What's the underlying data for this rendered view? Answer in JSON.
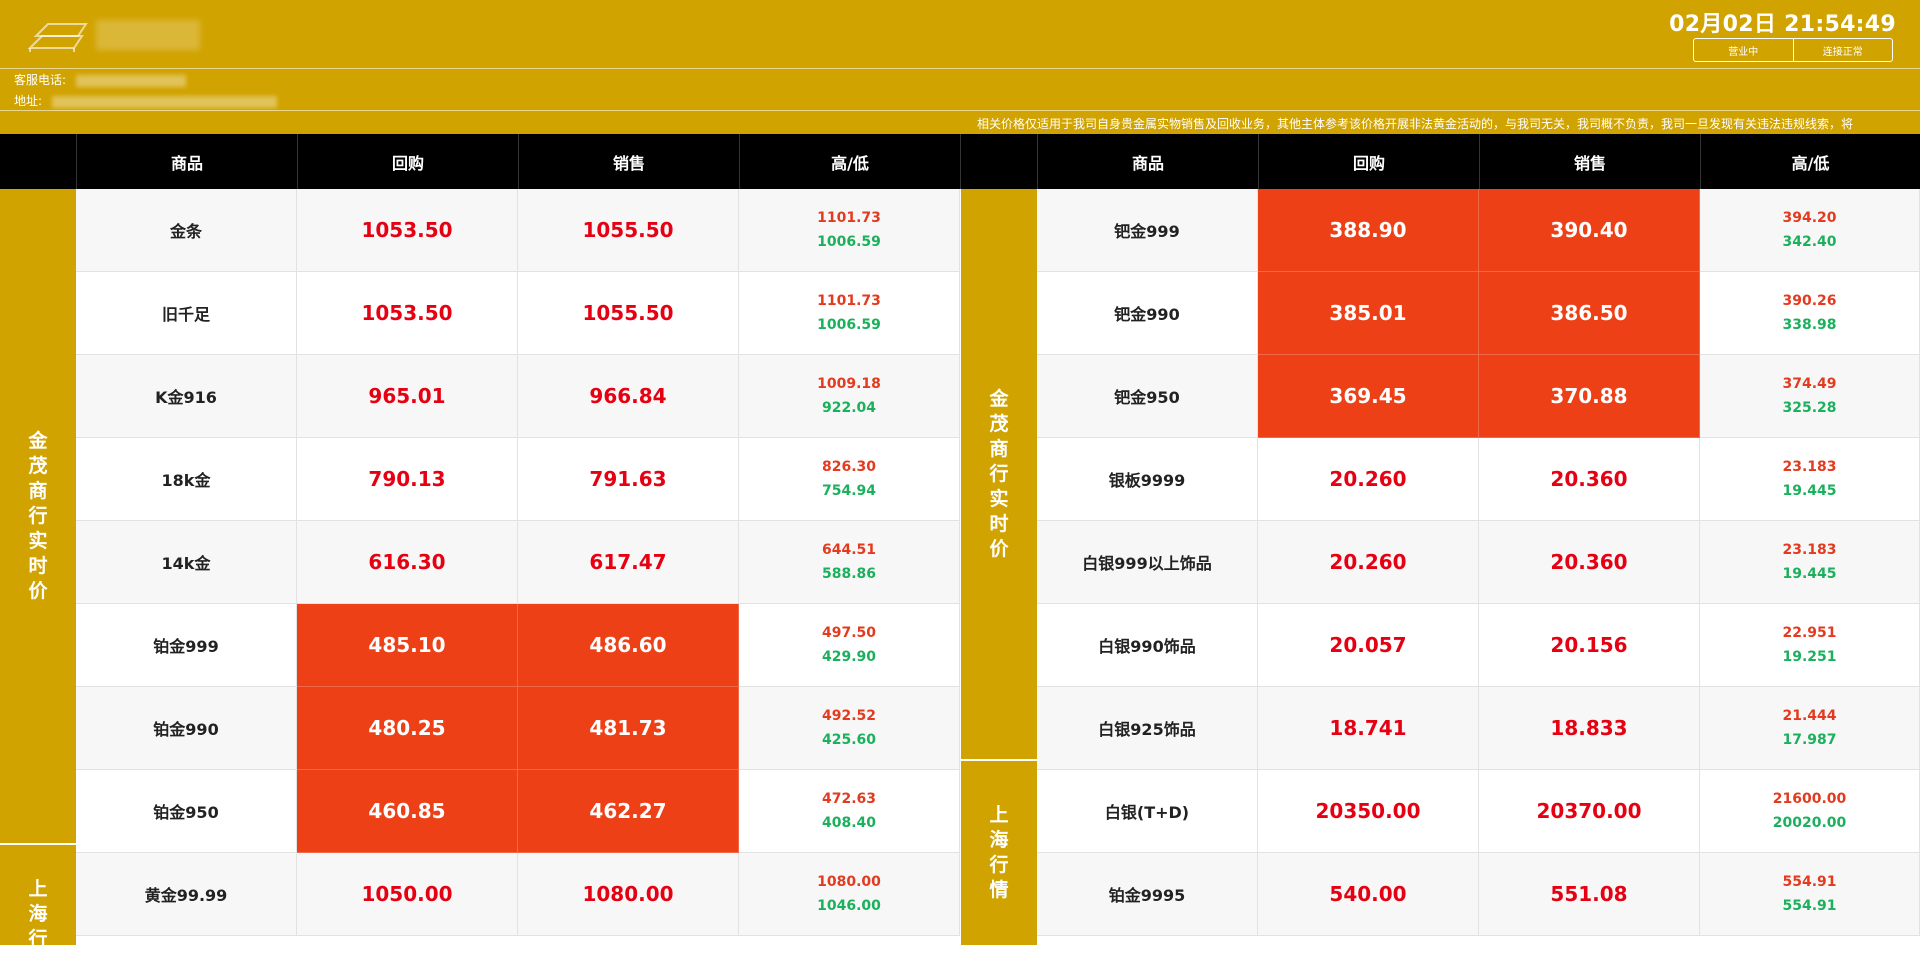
{
  "header": {
    "datetime": "02月02日 21:54:49",
    "status_open": "营业中",
    "status_conn": "连接正常",
    "phone_label": "客服电话:",
    "address_label": "地址:",
    "notice": "相关价格仅适用于我司自身贵金属实物销售及回收业务，其他主体参考该价格开展非法黄金活动的，与我司无关，我司概不负责，我司一旦发现有关违法违规线索，将"
  },
  "columns": {
    "left": [
      "商品",
      "回购",
      "销售",
      "高/低"
    ],
    "right": [
      "商品",
      "回购",
      "销售",
      "高/低"
    ]
  },
  "groups": {
    "left_top": "金茂商行实时价",
    "left_bottom": "上海行情",
    "right_top": "金茂商行实时价",
    "right_bottom": "上海行情"
  },
  "left_rows": [
    {
      "name": "金条",
      "buy": "1053.50",
      "sell": "1055.50",
      "high": "1101.73",
      "low": "1006.59"
    },
    {
      "name": "旧千足",
      "buy": "1053.50",
      "sell": "1055.50",
      "high": "1101.73",
      "low": "1006.59"
    },
    {
      "name": "K金916",
      "buy": "965.01",
      "sell": "966.84",
      "high": "1009.18",
      "low": "922.04"
    },
    {
      "name": "18k金",
      "buy": "790.13",
      "sell": "791.63",
      "high": "826.30",
      "low": "754.94"
    },
    {
      "name": "14k金",
      "buy": "616.30",
      "sell": "617.47",
      "high": "644.51",
      "low": "588.86"
    },
    {
      "name": "铂金999",
      "buy": "485.10",
      "sell": "486.60",
      "high": "497.50",
      "low": "429.90"
    },
    {
      "name": "铂金990",
      "buy": "480.25",
      "sell": "481.73",
      "high": "492.52",
      "low": "425.60"
    },
    {
      "name": "铂金950",
      "buy": "460.85",
      "sell": "462.27",
      "high": "472.63",
      "low": "408.40"
    },
    {
      "name": "黄金99.99",
      "buy": "1050.00",
      "sell": "1080.00",
      "high": "1080.00",
      "low": "1046.00"
    }
  ],
  "right_rows": [
    {
      "name": "钯金999",
      "buy": "388.90",
      "sell": "390.40",
      "high": "394.20",
      "low": "342.40"
    },
    {
      "name": "钯金990",
      "buy": "385.01",
      "sell": "386.50",
      "high": "390.26",
      "low": "338.98"
    },
    {
      "name": "钯金950",
      "buy": "369.45",
      "sell": "370.88",
      "high": "374.49",
      "low": "325.28"
    },
    {
      "name": "银板9999",
      "buy": "20.260",
      "sell": "20.360",
      "high": "23.183",
      "low": "19.445"
    },
    {
      "name": "白银999以上饰品",
      "buy": "20.260",
      "sell": "20.360",
      "high": "23.183",
      "low": "19.445"
    },
    {
      "name": "白银990饰品",
      "buy": "20.057",
      "sell": "20.156",
      "high": "22.951",
      "low": "19.251"
    },
    {
      "name": "白银925饰品",
      "buy": "18.741",
      "sell": "18.833",
      "high": "21.444",
      "low": "17.987"
    },
    {
      "name": "白银(T+D)",
      "buy": "20350.00",
      "sell": "20370.00",
      "high": "21600.00",
      "low": "20020.00"
    },
    {
      "name": "铂金9995",
      "buy": "540.00",
      "sell": "551.08",
      "high": "554.91",
      "low": "554.91"
    }
  ]
}
